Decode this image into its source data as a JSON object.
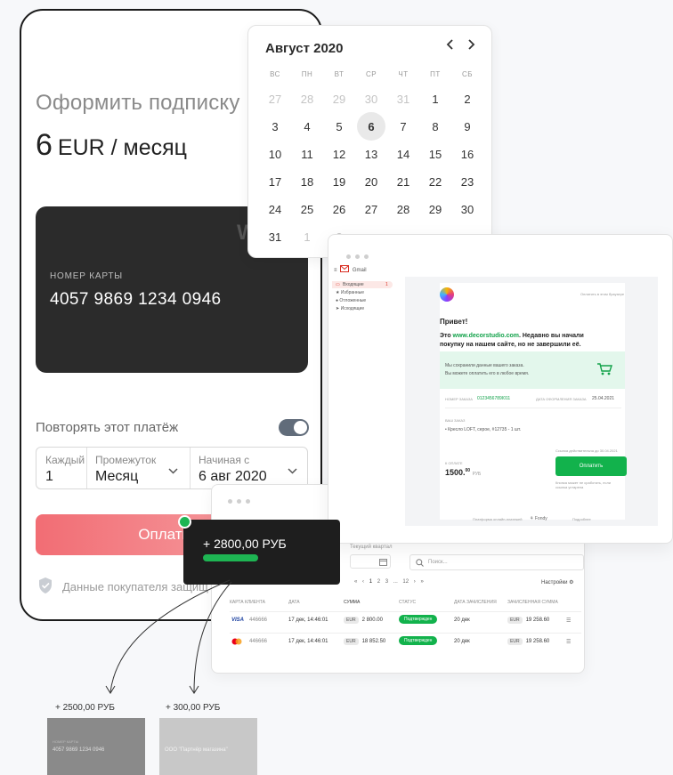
{
  "phone": {
    "title": "Оформить подписку",
    "price_amount": "6",
    "price_unit": "EUR / месяц",
    "card_logo": "W",
    "card_label": "НОМЕР КАРТЫ",
    "card_number": "4057 9869 1234 0946",
    "repeat_label": "Повторять этот платёж",
    "repeat_enabled": true,
    "every_label": "Каждый",
    "every_value": "1",
    "interval_label": "Промежуток",
    "interval_value": "Месяц",
    "start_label": "Начиная с",
    "start_value": "6 авг 2020",
    "pay_label": "Оплатить",
    "secure_text": "Данные покупателя защищ"
  },
  "calendar": {
    "title": "Август 2020",
    "prev": "‹",
    "next": "›",
    "weekdays": [
      "ВС",
      "ПН",
      "ВТ",
      "СР",
      "ЧТ",
      "ПТ",
      "СБ"
    ],
    "weeks": [
      [
        "27",
        "28",
        "29",
        "30",
        "31",
        "1",
        "2"
      ],
      [
        "3",
        "4",
        "5",
        "6",
        "7",
        "8",
        "9"
      ],
      [
        "10",
        "11",
        "12",
        "13",
        "14",
        "15",
        "16"
      ],
      [
        "17",
        "18",
        "19",
        "20",
        "21",
        "22",
        "23"
      ],
      [
        "24",
        "25",
        "26",
        "27",
        "28",
        "29",
        "30"
      ],
      [
        "31",
        "1",
        "2",
        "",
        "",
        "",
        ""
      ]
    ],
    "selected": "6"
  },
  "gmail": {
    "brand": "Gmail",
    "sidebar": [
      "Входящие",
      "Избранные",
      "Отложенные",
      "Исходящие"
    ],
    "inbox_count": "1",
    "top_link": "Оплатить в этом браузере",
    "greeting": "Привет!",
    "line1_prefix": "Это ",
    "site": "www.decorstudio.com",
    "line1_suffix": ". Недавно вы начали",
    "line2": "покупку на нашем сайте, но не завершили её.",
    "saved1": "Мы сохранили данные вашего заказа.",
    "saved2": "Вы можете оплатить его в любое время.",
    "order_label": "НОМЕР ЗАКАЗА",
    "order_number": "0123456789I011",
    "date_label": "ДАТА ОФОРМЛЕНИЯ ЗАКАЗА",
    "date_value": "25.04.2021",
    "items_label": "ВАШ ЗАКАЗ",
    "item": "Кресло LOFT, серое, #12735 - 1 шт.",
    "valid_text": "Ссылка действительна до 30.04.2021",
    "total_label": "К ОПЛАТЕ",
    "total_value": "1500.",
    "total_cents": "00",
    "total_currency": "РУБ",
    "pay_label": "Оплатить",
    "pay_note": "Кнопка может не сработать, если ссылка устарела",
    "footer": "Платформа онлайн-платежей",
    "footer_brand": "Fondy",
    "footer_link": "Подробнее"
  },
  "table": {
    "period_label": "Текущий квартал",
    "search_placeholder": "Поиск...",
    "pages": [
      "«",
      "‹",
      "1",
      "2",
      "3",
      "...",
      "12",
      "›",
      "»"
    ],
    "settings": "Настройки",
    "columns": [
      "КАРТА КЛИЕНТА",
      "ДАТА",
      "СУММА",
      "СТАТУС",
      "ДАТА ЗАЧИСЛЕНИЯ",
      "ЗАЧИСЛЕННАЯ СУММА"
    ],
    "rows": [
      {
        "brand": "VISA",
        "card": "446666",
        "date": "17 дек, 14:46:01",
        "cur": "EUR",
        "amount": "2 800.00",
        "status": "Подтвержден",
        "settle_date": "20 дек",
        "settle_cur": "EUR",
        "settle_amount": "19 258.60"
      },
      {
        "brand": "MC",
        "card": "446666",
        "date": "17 дек, 14:46:01",
        "cur": "EUR",
        "amount": "18 852.50",
        "status": "Подтвержден",
        "settle_date": "20 дек",
        "settle_cur": "EUR",
        "settle_amount": "19 258.60"
      }
    ]
  },
  "toast": {
    "amount": "+ 2800,00 РУБ"
  },
  "splits": [
    {
      "amount": "+ 2500,00 РУБ",
      "card_label": "НОМЕР КАРТЫ",
      "text": "4057 9869 1234 0946"
    },
    {
      "amount": "+ 300,00 РУБ",
      "text": "ООО \"Партнёр магазина\""
    }
  ],
  "colors": {
    "accent_green": "#1eb553",
    "pay_pink": "#f26d74",
    "card_dark": "#2b2b2b",
    "toggle": "#616c7a"
  }
}
